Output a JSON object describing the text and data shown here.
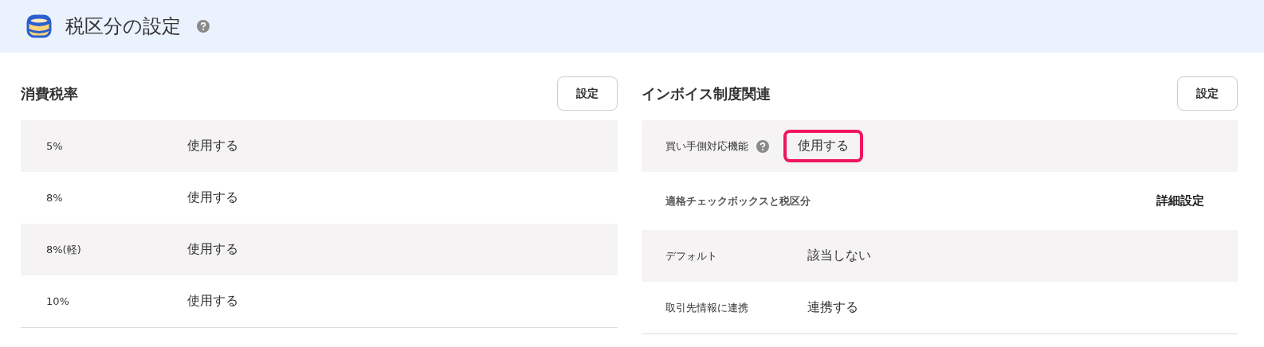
{
  "header": {
    "title": "税区分の設定"
  },
  "tax_rates": {
    "title": "消費税率",
    "button": "設定",
    "rows": [
      {
        "label": "5%",
        "value": "使用する"
      },
      {
        "label": "8%",
        "value": "使用する"
      },
      {
        "label": "8%(軽)",
        "value": "使用する"
      },
      {
        "label": "10%",
        "value": "使用する"
      }
    ]
  },
  "invoice": {
    "title": "インボイス制度関連",
    "button": "設定",
    "buyer_row": {
      "label": "買い手側対応機能",
      "value": "使用する",
      "highlighted": true
    },
    "subsection": {
      "title": "適格チェックボックスと税区分",
      "link": "詳細設定"
    },
    "rows": [
      {
        "label": "デフォルト",
        "value": "該当しない"
      },
      {
        "label": "取引先情報に連携",
        "value": "連携する"
      }
    ]
  }
}
